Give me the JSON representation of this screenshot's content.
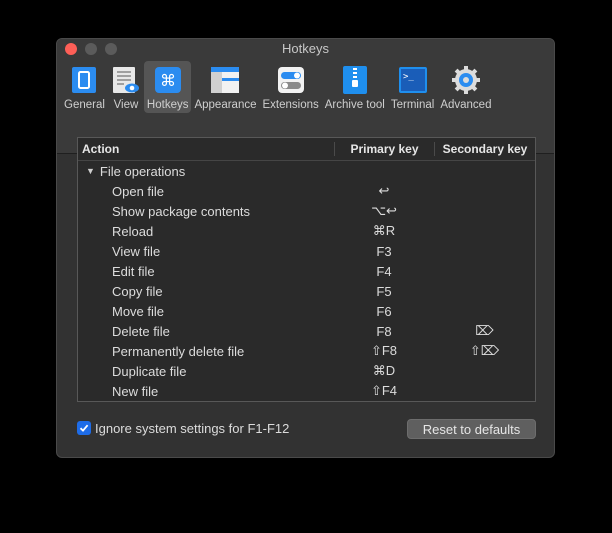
{
  "window": {
    "title": "Hotkeys"
  },
  "toolbar": [
    {
      "label": "General",
      "icon": "general-icon"
    },
    {
      "label": "View",
      "icon": "view-icon"
    },
    {
      "label": "Hotkeys",
      "icon": "command-key-icon"
    },
    {
      "label": "Appearance",
      "icon": "appearance-icon"
    },
    {
      "label": "Extensions",
      "icon": "toggles-icon"
    },
    {
      "label": "Archive tool",
      "icon": "zip-archive-icon"
    },
    {
      "label": "Terminal",
      "icon": "terminal-icon"
    },
    {
      "label": "Advanced",
      "icon": "gear-icon"
    }
  ],
  "table": {
    "headers": {
      "action": "Action",
      "primary": "Primary key",
      "secondary": "Secondary key"
    },
    "group": "File operations",
    "rows": [
      {
        "action": "Open file",
        "primary": "↩",
        "secondary": ""
      },
      {
        "action": "Show package contents",
        "primary": "⌥↩",
        "secondary": ""
      },
      {
        "action": "Reload",
        "primary": "⌘R",
        "secondary": ""
      },
      {
        "action": "View file",
        "primary": "F3",
        "secondary": ""
      },
      {
        "action": "Edit file",
        "primary": "F4",
        "secondary": ""
      },
      {
        "action": "Copy file",
        "primary": "F5",
        "secondary": ""
      },
      {
        "action": "Move file",
        "primary": "F6",
        "secondary": ""
      },
      {
        "action": "Delete file",
        "primary": "F8",
        "secondary": "⌦"
      },
      {
        "action": "Permanently delete file",
        "primary": "⇧F8",
        "secondary": "⇧⌦"
      },
      {
        "action": "Duplicate file",
        "primary": "⌘D",
        "secondary": ""
      },
      {
        "action": "New file",
        "primary": "⇧F4",
        "secondary": ""
      }
    ]
  },
  "footer": {
    "checkbox_label": "Ignore system settings for F1-F12",
    "checkbox_checked": true,
    "reset_label": "Reset to defaults"
  },
  "colors": {
    "accent": "#1e6ce8",
    "close": "#fe5f57"
  }
}
